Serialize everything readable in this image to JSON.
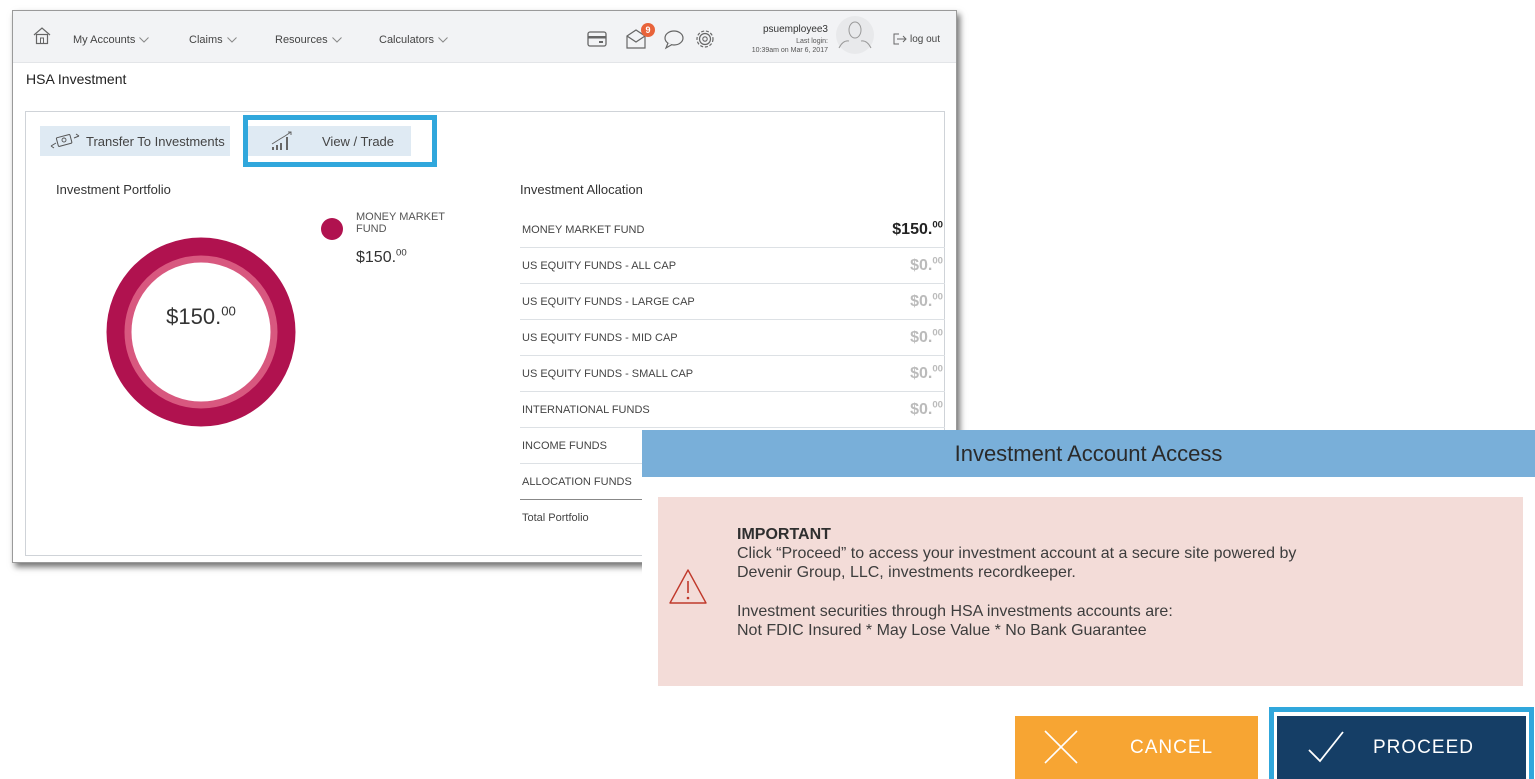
{
  "nav": {
    "items": [
      {
        "label": "My Accounts"
      },
      {
        "label": "Claims"
      },
      {
        "label": "Resources"
      },
      {
        "label": "Calculators"
      }
    ],
    "notification_count": "9",
    "user": {
      "name": "psuemployee3",
      "last_login_label": "Last login:",
      "last_login_value": "10:39am on Mar 6, 2017"
    },
    "logout_label": "log out"
  },
  "page": {
    "title": "HSA Investment",
    "actions": {
      "transfer_label": "Transfer To Investments",
      "view_trade_label": "View / Trade"
    },
    "portfolio": {
      "heading": "Investment Portfolio",
      "total_whole": "$150.",
      "total_cents": "00",
      "legend": {
        "name": "MONEY MARKET FUND",
        "value_whole": "$150.",
        "value_cents": "00",
        "color": "#b0124f"
      }
    },
    "allocation": {
      "heading": "Investment Allocation",
      "rows": [
        {
          "name": "MONEY MARKET FUND",
          "whole": "$150.",
          "cents": "00"
        },
        {
          "name": "US EQUITY FUNDS - ALL CAP",
          "whole": "$0.",
          "cents": "00"
        },
        {
          "name": "US EQUITY FUNDS - LARGE CAP",
          "whole": "$0.",
          "cents": "00"
        },
        {
          "name": "US EQUITY FUNDS - MID CAP",
          "whole": "$0.",
          "cents": "00"
        },
        {
          "name": "US EQUITY FUNDS - SMALL CAP",
          "whole": "$0.",
          "cents": "00"
        },
        {
          "name": "INTERNATIONAL FUNDS",
          "whole": "$0.",
          "cents": "00"
        },
        {
          "name": "INCOME FUNDS"
        },
        {
          "name": "ALLOCATION FUNDS"
        }
      ],
      "total_label": "Total Portfolio"
    }
  },
  "modal": {
    "title": "Investment Account Access",
    "notice_title": "IMPORTANT",
    "line1": "Click “Proceed” to access your investment account at a secure site powered by",
    "line2": "Devenir Group, LLC, investments recordkeeper.",
    "line3": "Investment securities through HSA investments accounts are:",
    "line4": "Not FDIC Insured * May Lose Value * No Bank Guarantee",
    "cancel_label": "CANCEL",
    "proceed_label": "PROCEED"
  },
  "colors": {
    "donut": "#b0124f",
    "highlight": "#30a7dc",
    "modal_header": "#79afd9",
    "cancel": "#f7a533",
    "proceed": "#153e66"
  },
  "icons": [
    "home-icon",
    "chevron-down-icon",
    "card-icon",
    "mail-icon",
    "chat-icon",
    "gear-icon",
    "avatar-icon",
    "logout-icon",
    "transfer-icon",
    "chart-icon",
    "warning-icon",
    "close-icon",
    "check-icon"
  ]
}
